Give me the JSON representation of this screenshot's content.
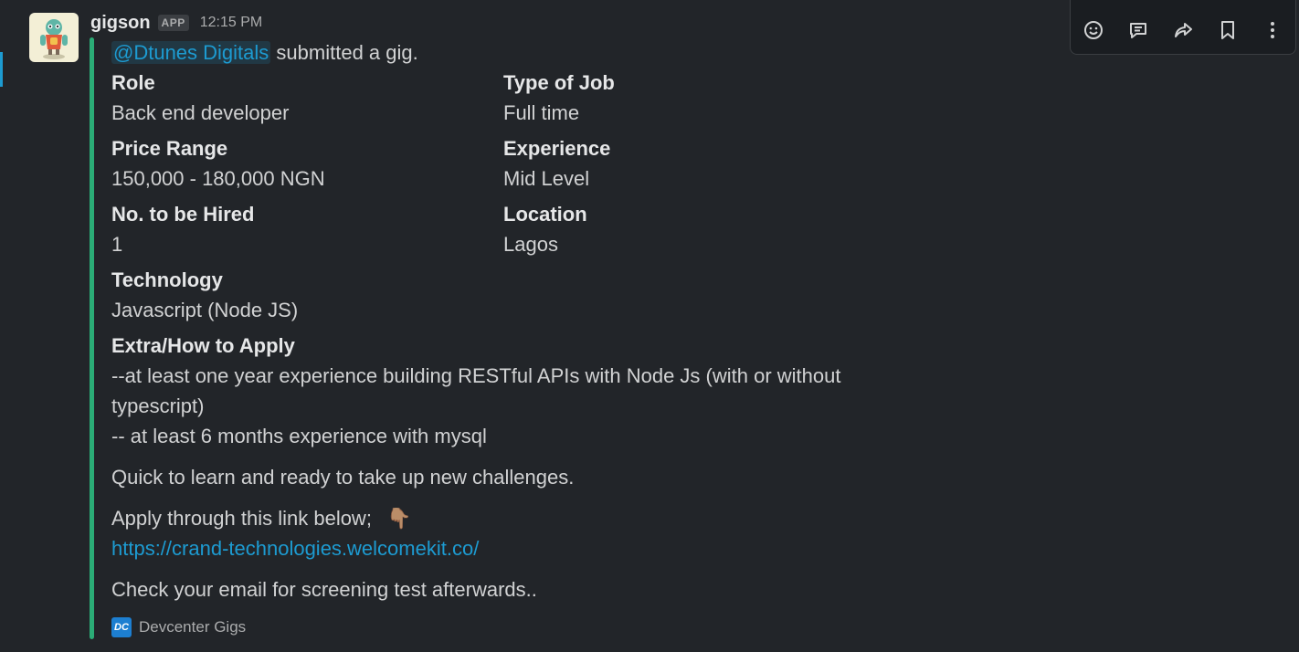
{
  "message": {
    "username": "gigson",
    "badge": "APP",
    "time": "12:15 PM",
    "mention": "@Dtunes Digitals",
    "intro": "submitted a gig."
  },
  "fields": {
    "role_label": "Role",
    "role_value": "Back end developer",
    "type_label": "Type of Job",
    "type_value": "Full time",
    "price_label": "Price Range",
    "price_value": "150,000 - 180,000 NGN",
    "experience_label": "Experience",
    "experience_value": "Mid Level",
    "hired_label": "No. to be Hired",
    "hired_value": "1",
    "location_label": "Location",
    "location_value": "Lagos",
    "technology_label": "Technology",
    "technology_value": "Javascript (Node JS)",
    "extra_label": "Extra/How to Apply",
    "extra_line1": "--at least one year experience building RESTful APIs with Node Js (with or without",
    "extra_line2": "typescript)",
    "extra_line3": "-- at least 6 months experience with mysql",
    "quick_line": "Quick to learn and ready to take up new challenges.",
    "apply_line": "Apply through this link below;",
    "apply_emoji": "👇🏽",
    "apply_link": "https://crand-technologies.welcomekit.co/",
    "check_line": "Check your email for screening test afterwards.."
  },
  "footer": {
    "logo_text": "DC",
    "source": "Devcenter Gigs"
  },
  "toolbar": {
    "icons": [
      "emoji-reaction-icon",
      "reply-thread-icon",
      "share-forward-icon",
      "bookmark-icon",
      "more-options-icon"
    ]
  },
  "colors": {
    "background": "#222529",
    "accent_bar": "#2bac76",
    "link": "#1d9bd1"
  }
}
